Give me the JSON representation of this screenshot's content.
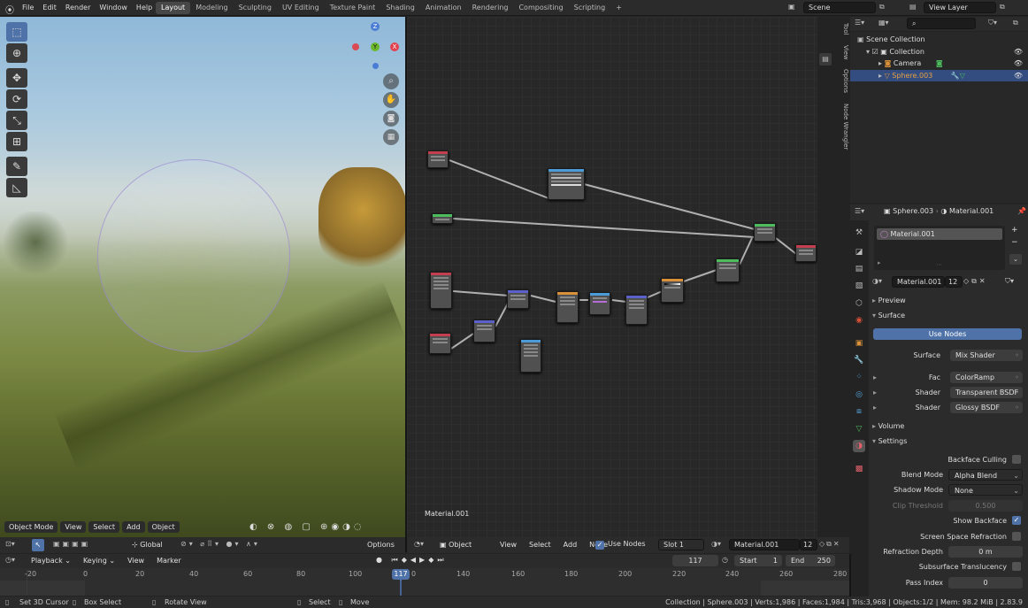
{
  "menu": [
    "File",
    "Edit",
    "Render",
    "Window",
    "Help"
  ],
  "workspaces": [
    "Layout",
    "Modeling",
    "Sculpting",
    "UV Editing",
    "Texture Paint",
    "Shading",
    "Animation",
    "Rendering",
    "Compositing",
    "Scripting"
  ],
  "active_workspace": "Layout",
  "scene_label": "Scene",
  "view_layer_label": "View Layer",
  "viewport": {
    "mode": "Object Mode",
    "menus": [
      "View",
      "Select",
      "Add",
      "Object"
    ],
    "transform": "Global",
    "options": "Options",
    "gizmo": {
      "z": "Z",
      "y": "Y",
      "x": "X"
    }
  },
  "node_editor": {
    "type": "Object",
    "menus": [
      "View",
      "Select",
      "Add",
      "Node"
    ],
    "use_nodes": "Use Nodes",
    "slot": "Slot 1",
    "material": "Material.001",
    "users": "12",
    "label": "Material.001",
    "tabs": [
      "Tool",
      "View",
      "Options",
      "Node Wrangler"
    ]
  },
  "outliner": {
    "root": "Scene Collection",
    "items": [
      {
        "label": "Collection"
      },
      {
        "label": "Camera"
      },
      {
        "label": "Sphere.003"
      }
    ]
  },
  "properties": {
    "breadcrumb_object": "Sphere.003",
    "breadcrumb_material": "Material.001",
    "slot_item": "Material.001",
    "material_name": "Material.001",
    "users": "12",
    "sections": {
      "preview": "Preview",
      "surface": "Surface",
      "volume": "Volume",
      "settings": "Settings"
    },
    "use_nodes": "Use Nodes",
    "surface": [
      {
        "label": "Surface",
        "value": "Mix Shader"
      },
      {
        "label": "Fac",
        "value": "ColorRamp"
      },
      {
        "label": "Shader",
        "value": "Transparent BSDF"
      },
      {
        "label": "Shader",
        "value": "Glossy BSDF"
      }
    ],
    "settings": {
      "backface_culling": "Backface Culling",
      "blend_mode_label": "Blend Mode",
      "blend_mode": "Alpha Blend",
      "shadow_mode_label": "Shadow Mode",
      "shadow_mode": "None",
      "clip_label": "Clip Threshold",
      "clip": "0.500",
      "show_backface": "Show Backface",
      "ssr": "Screen Space Refraction",
      "refraction_label": "Refraction Depth",
      "refraction": "0 m",
      "sss": "Subsurface Translucency",
      "pass_label": "Pass Index",
      "pass": "0"
    }
  },
  "timeline": {
    "menus": [
      "Playback",
      "Keying",
      "View",
      "Marker"
    ],
    "current": "117",
    "start_label": "Start",
    "start": "1",
    "end_label": "End",
    "end": "250",
    "ticks": [
      "-20",
      "0",
      "20",
      "40",
      "60",
      "80",
      "100",
      "0",
      "140",
      "160",
      "180",
      "200",
      "220",
      "240",
      "260",
      "280"
    ],
    "cursor_label": "117"
  },
  "status": {
    "left": [
      "Set 3D Cursor",
      "Box Select",
      "Rotate View"
    ],
    "mid": [
      "Select",
      "Move"
    ],
    "right": "Collection | Sphere.003 | Verts:1,986 | Faces:1,984 | Tris:3,968 | Objects:1/2 | Mem: 98.2 MiB | 2.83.9"
  }
}
